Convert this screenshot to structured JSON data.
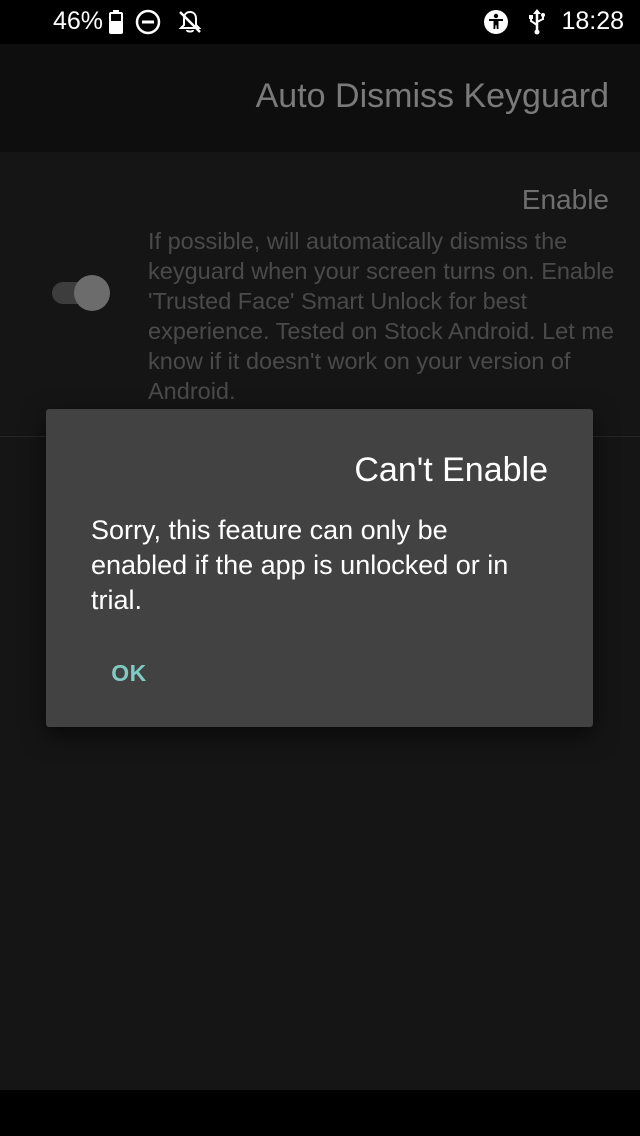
{
  "status_bar": {
    "battery_percent": "46%",
    "time": "18:28",
    "icons": [
      "battery-icon",
      "do-not-disturb-icon",
      "notifications-off-icon",
      "accessibility-icon",
      "usb-icon"
    ]
  },
  "toolbar": {
    "title": "Auto Dismiss Keyguard"
  },
  "preference": {
    "title": "Enable",
    "summary": "If possible, will automatically dismiss the keyguard when your screen turns on. Enable 'Trusted Face' Smart Unlock for best experience. Tested on Stock Android. Let me know if it doesn't work on your version of Android.",
    "switch_on": true
  },
  "dialog": {
    "title": "Can't Enable",
    "message": "Sorry, this feature can only be enabled if the app is unlocked or in trial.",
    "ok_label": "OK"
  },
  "colors": {
    "accent": "#80cbc4",
    "dialog_bg": "#424242",
    "app_bg": "#151515"
  }
}
